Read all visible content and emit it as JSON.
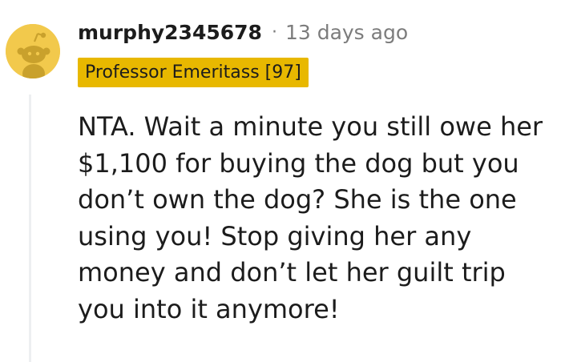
{
  "comment": {
    "avatar_icon": "reddit-snoo-avatar-icon",
    "avatar_color": "#f2c94c",
    "username": "murphy2345678",
    "separator": "·",
    "timestamp": "13 days ago",
    "flair": {
      "text": "Professor Emeritass [97]",
      "background": "#e8b800"
    },
    "body_lines": [
      "NTA. Wait a minute you still owe her",
      "$1,100 for buying the dog but you",
      "don’t own the dog? She is the one",
      "using you! Stop giving her any",
      "money and don’t let her guilt trip",
      "you into it anymore!"
    ]
  }
}
